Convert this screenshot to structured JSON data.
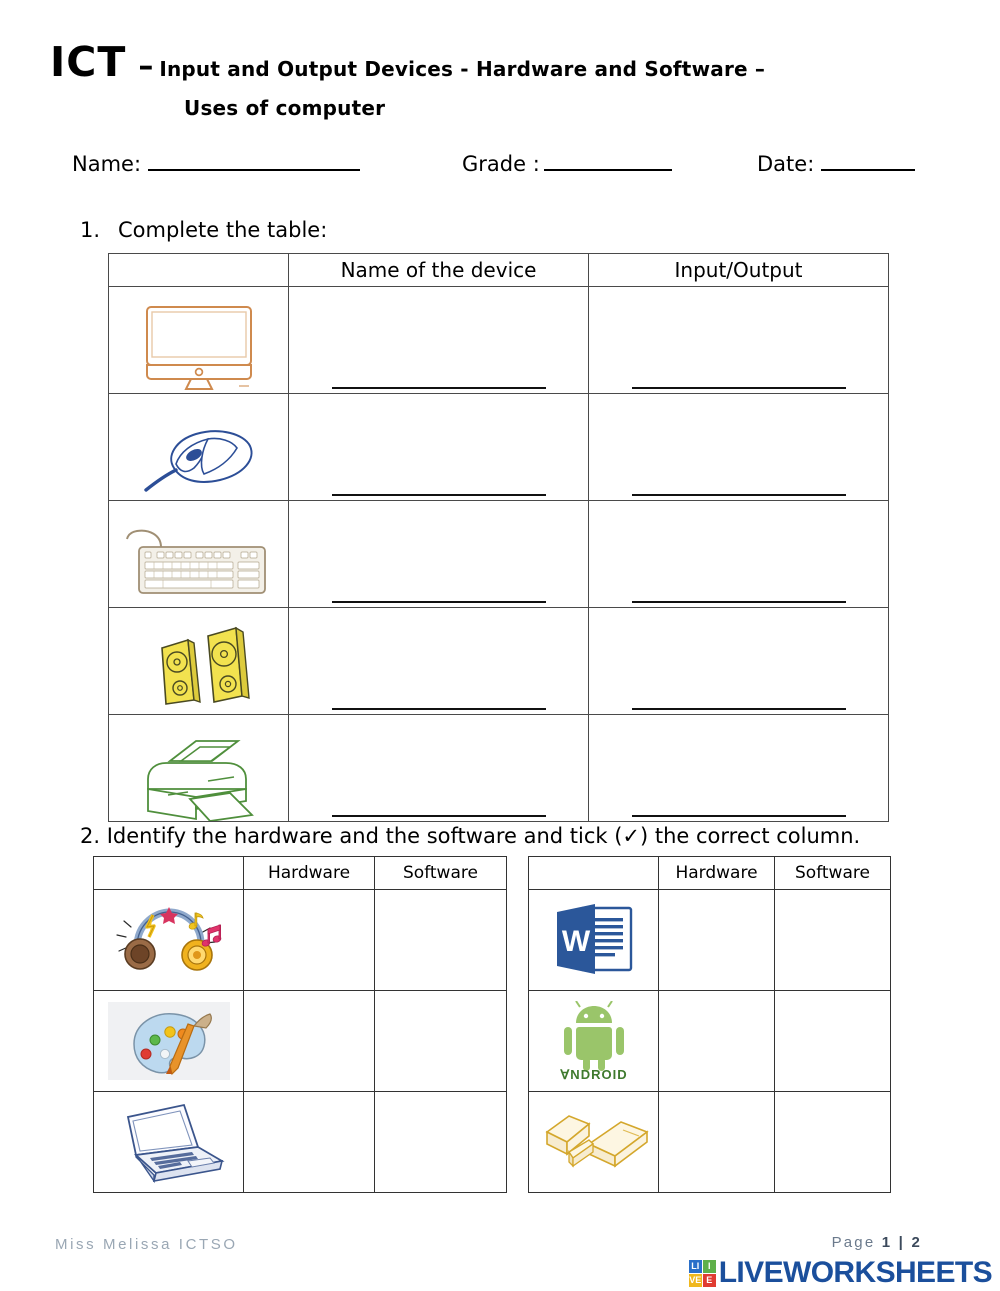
{
  "header": {
    "title_main": "ICT",
    "title_dash": "–",
    "title_sub": "Input and Output Devices -  Hardware and Software –",
    "title_line2": "Uses of computer"
  },
  "info": {
    "name_label": "Name:",
    "grade_label": "Grade :",
    "date_label": "Date:",
    "name_value": "",
    "grade_value": "",
    "date_value": ""
  },
  "question1": {
    "number": "1.",
    "text": "Complete the table:",
    "columns": [
      "",
      "Name of the device",
      "Input/Output"
    ],
    "rows": [
      {
        "icon": "monitor-icon",
        "color": "#cf8a4e",
        "name_answer": "",
        "io_answer": ""
      },
      {
        "icon": "mouse-icon",
        "color": "#2c4e97",
        "name_answer": "",
        "io_answer": ""
      },
      {
        "icon": "keyboard-icon",
        "color": "#a08f74",
        "name_answer": "",
        "io_answer": ""
      },
      {
        "icon": "speakers-icon",
        "color": "#e8d64a",
        "name_answer": "",
        "io_answer": ""
      },
      {
        "icon": "printer-icon",
        "color": "#4f8f3c",
        "name_answer": "",
        "io_answer": ""
      }
    ]
  },
  "question2": {
    "number": "2.",
    "text": "Identify the hardware and the software and tick (✓) the correct column.",
    "columns": [
      "",
      "Hardware",
      "Software"
    ],
    "left_rows": [
      {
        "icon": "headphones-icon",
        "hardware_tick": "",
        "software_tick": ""
      },
      {
        "icon": "paint-palette-icon",
        "hardware_tick": "",
        "software_tick": ""
      },
      {
        "icon": "laptop-icon",
        "hardware_tick": "",
        "software_tick": ""
      }
    ],
    "right_rows": [
      {
        "icon": "microsoft-word-icon",
        "hardware_tick": "",
        "software_tick": ""
      },
      {
        "icon": "android-icon",
        "hardware_tick": "",
        "software_tick": ""
      },
      {
        "icon": "usb-flash-drive-icon",
        "hardware_tick": "",
        "software_tick": ""
      }
    ]
  },
  "footer": {
    "author": "Miss Melissa ICTSO",
    "page_prefix": "Page ",
    "page_current": "1",
    "page_separator": " | ",
    "page_total": "2",
    "brand": "LIVEWORKSHEETS",
    "brand_squares": [
      {
        "letter": "LI",
        "color": "#2a6fc9"
      },
      {
        "letter": "I",
        "color": "#5fb04a"
      },
      {
        "letter": "VE",
        "color": "#efc game"
      }
    ]
  },
  "colors": {
    "brand_blue": "#1b4f9c",
    "footer_gray": "#9aa7b4"
  }
}
